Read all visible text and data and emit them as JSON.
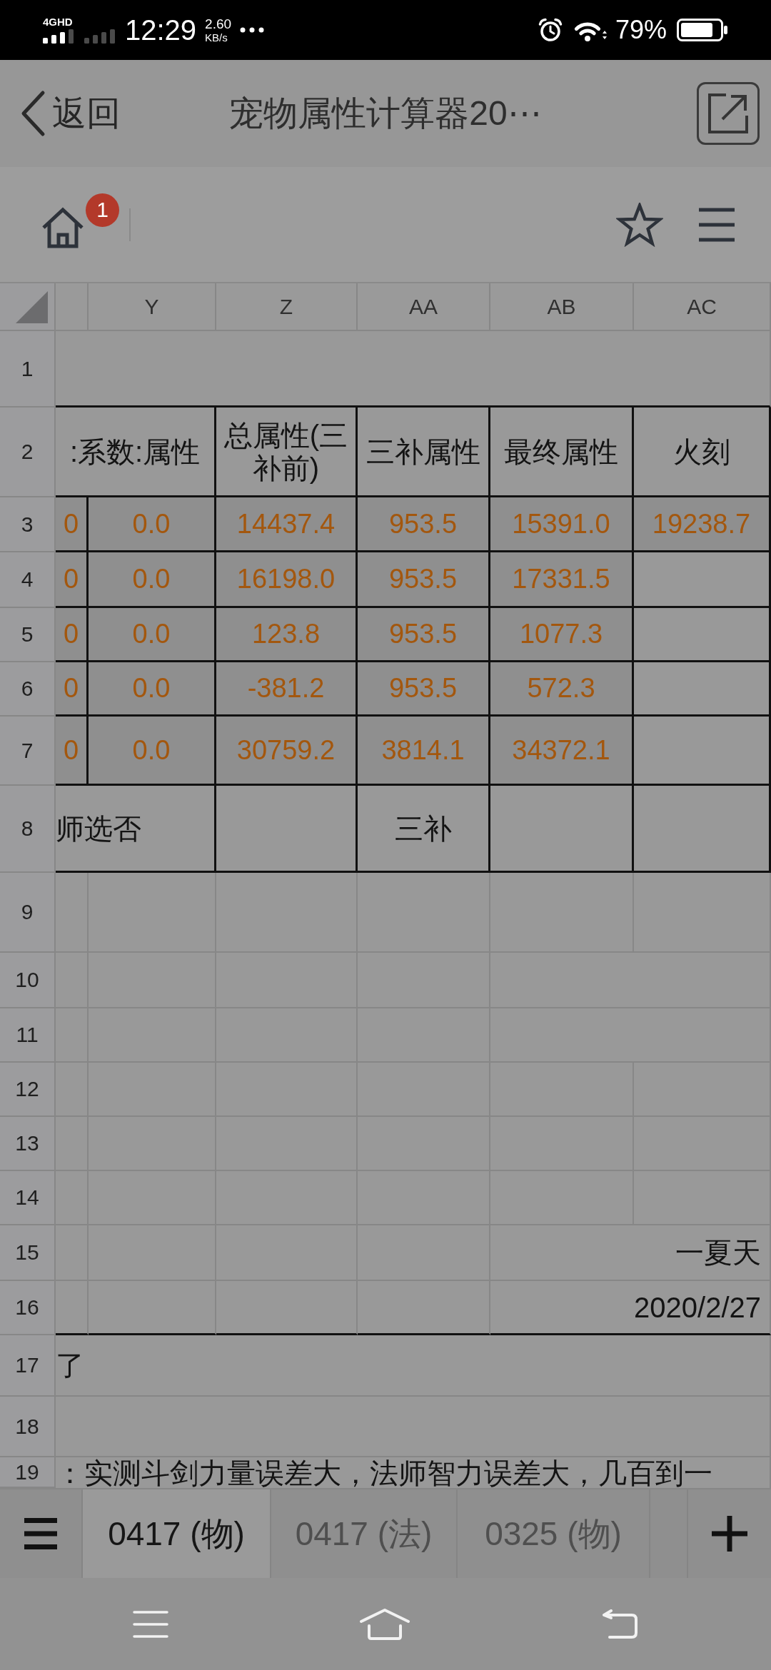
{
  "status_bar": {
    "network": "4GHD",
    "time": "12:29",
    "speed": "2.60",
    "speed_unit": "KB/s",
    "battery": "79%"
  },
  "title_bar": {
    "back": "返回",
    "title": "宠物属性计算器20⋯"
  },
  "toolbar": {
    "home_badge": "1"
  },
  "sheet": {
    "column_headers": [
      "Y",
      "Z",
      "AA",
      "AB",
      "AC"
    ],
    "rows": [
      {
        "number": "1",
        "kind": "plain",
        "cells": [
          {
            "kind": "blank"
          },
          {
            "kind": "merged"
          },
          {
            "kind": "merged"
          },
          {
            "kind": "merged"
          },
          {
            "kind": "merged"
          },
          {
            "kind": "merged"
          }
        ]
      },
      {
        "number": "2",
        "kind": "boxed",
        "cells": [
          {
            "kind": "heading",
            "text": ":系数:属性"
          },
          {
            "kind": "merged"
          },
          {
            "kind": "heading",
            "text": "总属性(三补前)"
          },
          {
            "kind": "heading",
            "text": "三补属性"
          },
          {
            "kind": "heading",
            "text": "最终属性"
          },
          {
            "kind": "heading",
            "text": "火刻"
          }
        ]
      },
      {
        "number": "3",
        "kind": "boxed",
        "cells": [
          {
            "kind": "number",
            "text": "0"
          },
          {
            "kind": "number",
            "text": "0.0"
          },
          {
            "kind": "number",
            "text": "14437.4"
          },
          {
            "kind": "number",
            "text": "953.5"
          },
          {
            "kind": "number",
            "text": "15391.0"
          },
          {
            "kind": "number",
            "text": "19238.7"
          }
        ]
      },
      {
        "number": "4",
        "kind": "boxed",
        "cells": [
          {
            "kind": "number",
            "text": "0"
          },
          {
            "kind": "number",
            "text": "0.0"
          },
          {
            "kind": "number",
            "text": "16198.0"
          },
          {
            "kind": "number",
            "text": "953.5"
          },
          {
            "kind": "number",
            "text": "17331.5"
          },
          {
            "kind": "blank"
          }
        ]
      },
      {
        "number": "5",
        "kind": "boxed",
        "cells": [
          {
            "kind": "number",
            "text": "0"
          },
          {
            "kind": "number",
            "text": "0.0"
          },
          {
            "kind": "number",
            "text": "123.8"
          },
          {
            "kind": "number",
            "text": "953.5"
          },
          {
            "kind": "number",
            "text": "1077.3"
          },
          {
            "kind": "blank"
          }
        ]
      },
      {
        "number": "6",
        "kind": "boxed",
        "cells": [
          {
            "kind": "number",
            "text": "0"
          },
          {
            "kind": "number",
            "text": "0.0"
          },
          {
            "kind": "number",
            "text": "-381.2"
          },
          {
            "kind": "number",
            "text": "953.5"
          },
          {
            "kind": "number",
            "text": "572.3"
          },
          {
            "kind": "blank"
          }
        ]
      },
      {
        "number": "7",
        "kind": "boxed",
        "cells": [
          {
            "kind": "number",
            "text": "0"
          },
          {
            "kind": "number",
            "text": "0.0"
          },
          {
            "kind": "number",
            "text": "30759.2"
          },
          {
            "kind": "number",
            "text": "3814.1"
          },
          {
            "kind": "number",
            "text": "34372.1"
          },
          {
            "kind": "blank"
          }
        ]
      },
      {
        "number": "8",
        "kind": "boxed",
        "cells": [
          {
            "kind": "text",
            "text": "师选否"
          },
          {
            "kind": "merged"
          },
          {
            "kind": "blank"
          },
          {
            "kind": "heading",
            "text": "三补"
          },
          {
            "kind": "blank"
          },
          {
            "kind": "blank"
          }
        ]
      },
      {
        "number": "9",
        "kind": "plain",
        "cells": [
          {
            "kind": "blank"
          },
          {
            "kind": "blank"
          },
          {
            "kind": "blank"
          },
          {
            "kind": "blank"
          },
          {
            "kind": "blank"
          },
          {
            "kind": "blank"
          }
        ]
      },
      {
        "number": "10",
        "kind": "plain",
        "cells": [
          {
            "kind": "blank"
          },
          {
            "kind": "blank"
          },
          {
            "kind": "blank"
          },
          {
            "kind": "blank"
          },
          {
            "kind": "blank"
          },
          {
            "kind": "merged"
          }
        ]
      },
      {
        "number": "11",
        "kind": "plain",
        "cells": [
          {
            "kind": "blank"
          },
          {
            "kind": "blank"
          },
          {
            "kind": "blank"
          },
          {
            "kind": "blank"
          },
          {
            "kind": "blank"
          },
          {
            "kind": "merged"
          }
        ]
      },
      {
        "number": "12",
        "kind": "plain",
        "cells": [
          {
            "kind": "blank"
          },
          {
            "kind": "blank"
          },
          {
            "kind": "blank"
          },
          {
            "kind": "blank"
          },
          {
            "kind": "blank"
          },
          {
            "kind": "blank"
          }
        ]
      },
      {
        "number": "13",
        "kind": "plain",
        "cells": [
          {
            "kind": "blank"
          },
          {
            "kind": "blank"
          },
          {
            "kind": "blank"
          },
          {
            "kind": "blank"
          },
          {
            "kind": "blank"
          },
          {
            "kind": "blank"
          }
        ]
      },
      {
        "number": "14",
        "kind": "plain",
        "cells": [
          {
            "kind": "blank"
          },
          {
            "kind": "blank"
          },
          {
            "kind": "blank"
          },
          {
            "kind": "blank"
          },
          {
            "kind": "blank"
          },
          {
            "kind": "blank"
          }
        ]
      },
      {
        "number": "15",
        "kind": "plain",
        "cells": [
          {
            "kind": "blank"
          },
          {
            "kind": "blank"
          },
          {
            "kind": "blank"
          },
          {
            "kind": "blank"
          },
          {
            "kind": "signature",
            "text": "一夏天"
          },
          {
            "kind": "merged"
          }
        ]
      },
      {
        "number": "16",
        "kind": "plain",
        "cells": [
          {
            "kind": "blank"
          },
          {
            "kind": "blank"
          },
          {
            "kind": "blank"
          },
          {
            "kind": "blank"
          },
          {
            "kind": "signature",
            "text": "2020/2/27"
          },
          {
            "kind": "merged"
          }
        ]
      },
      {
        "number": "17",
        "kind": "ruled",
        "cells": [
          {
            "kind": "text",
            "text": "了"
          },
          {
            "kind": "merged"
          },
          {
            "kind": "merged"
          },
          {
            "kind": "merged"
          },
          {
            "kind": "merged"
          },
          {
            "kind": "merged"
          }
        ]
      },
      {
        "number": "18",
        "kind": "plain",
        "cells": [
          {
            "kind": "blank"
          },
          {
            "kind": "merged"
          },
          {
            "kind": "merged"
          },
          {
            "kind": "merged"
          },
          {
            "kind": "merged"
          },
          {
            "kind": "merged"
          }
        ]
      },
      {
        "number": "19",
        "kind": "plain",
        "cells": [
          {
            "kind": "text",
            "text": "：实测斗剑力量误差大，法师智力误差大，几百到一"
          },
          {
            "kind": "merged"
          },
          {
            "kind": "merged"
          },
          {
            "kind": "merged"
          },
          {
            "kind": "merged"
          },
          {
            "kind": "merged"
          }
        ]
      }
    ]
  },
  "sheet_tabs": [
    {
      "label": "0417 (物)",
      "selected": true
    },
    {
      "label": "0417 (法)",
      "selected": false
    },
    {
      "label": "0325 (物)",
      "selected": false
    }
  ]
}
